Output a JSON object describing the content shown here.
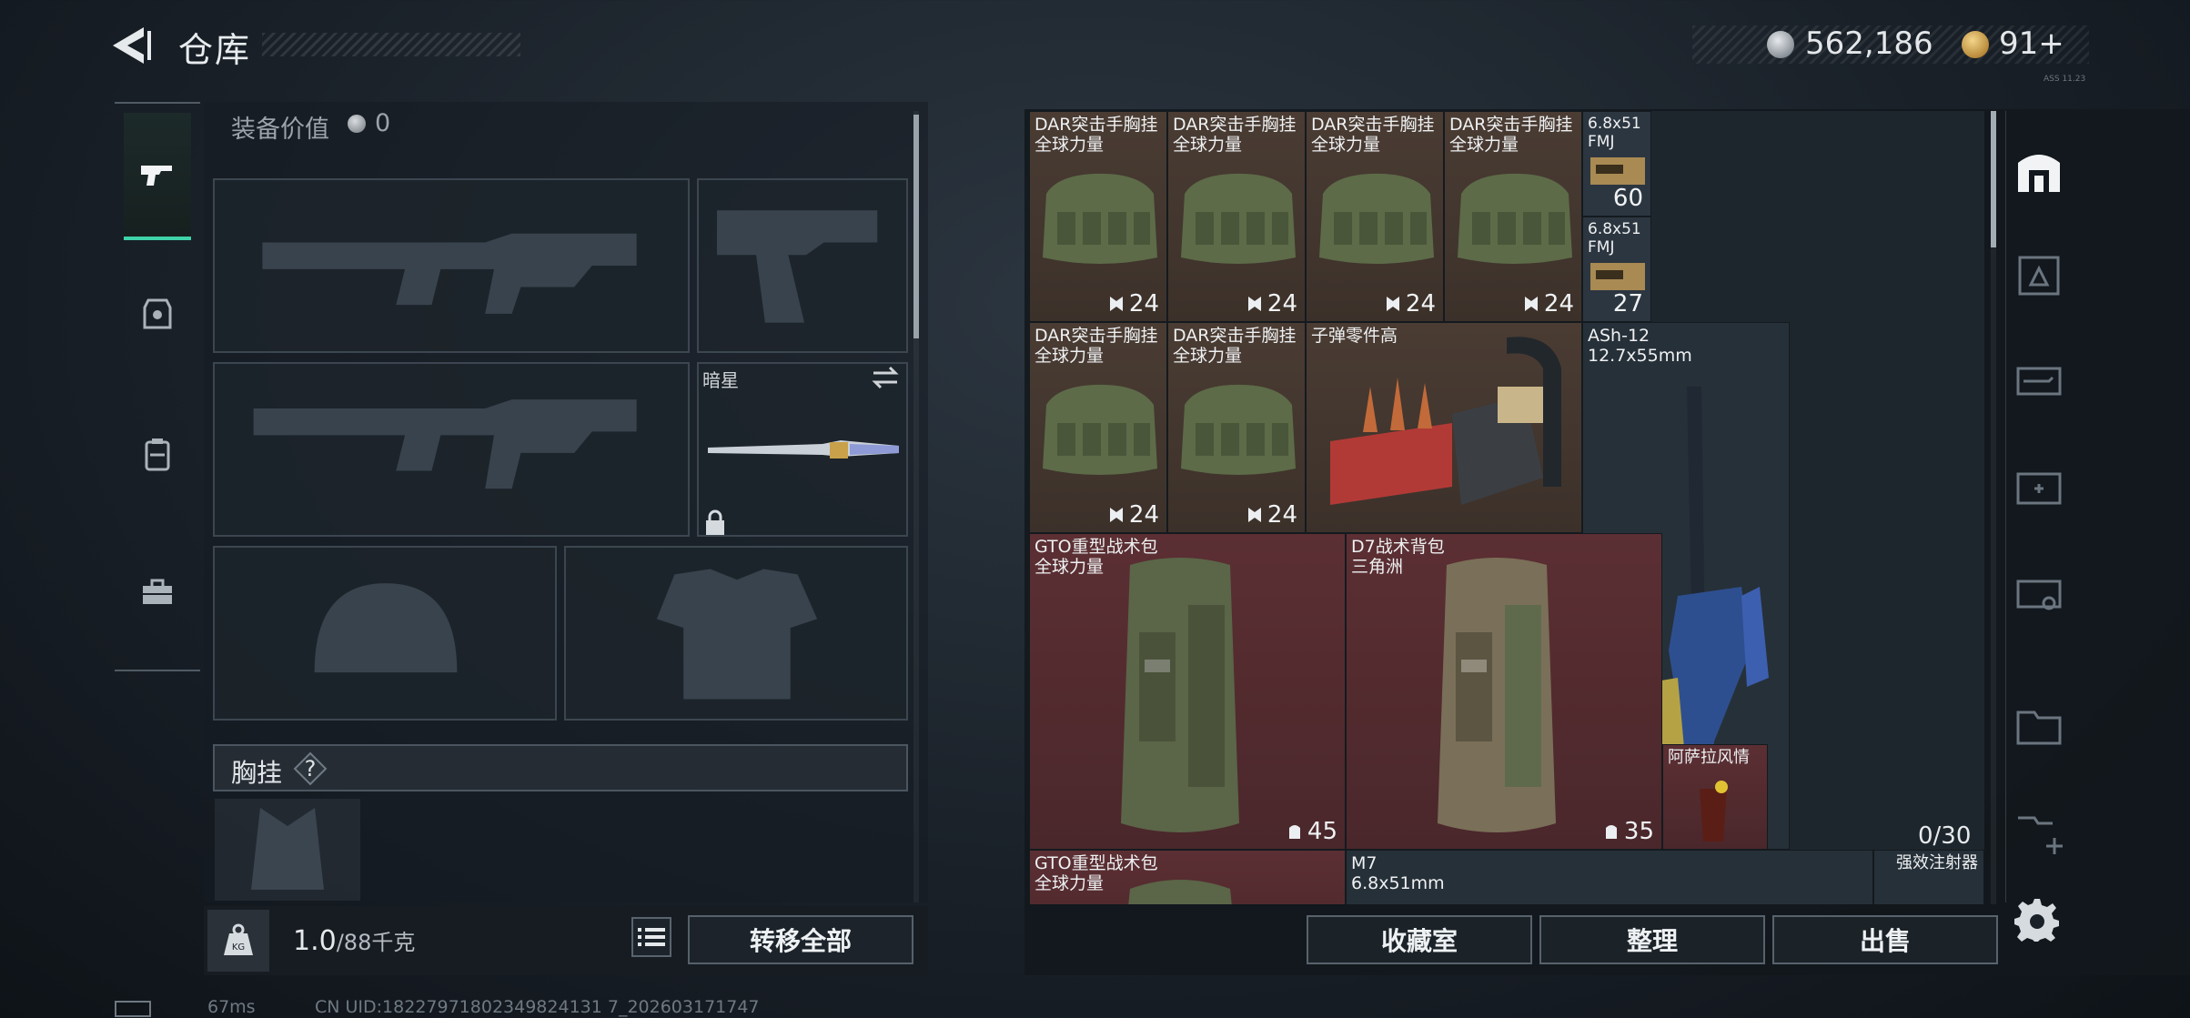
{
  "header": {
    "title": "仓库",
    "money": "562,186",
    "coupons": "91+",
    "tiny_tag": "ASS 11.23"
  },
  "equipment": {
    "value_label": "装备价值",
    "value": "0",
    "melee_label": "暗星",
    "rig_label": "胸挂",
    "help": "?"
  },
  "weight": {
    "current": "1.0",
    "max": "/88千克",
    "icon_text": "KG"
  },
  "actions": {
    "transfer_all": "转移全部",
    "collection": "收藏室",
    "organize": "整理",
    "sell": "出售"
  },
  "stash": {
    "items": [
      {
        "name": "DAR突击手胸挂",
        "sub": "全球力量",
        "count": "24"
      },
      {
        "name": "DAR突击手胸挂",
        "sub": "全球力量",
        "count": "24"
      },
      {
        "name": "DAR突击手胸挂",
        "sub": "全球力量",
        "count": "24"
      },
      {
        "name": "DAR突击手胸挂",
        "sub": "全球力量",
        "count": "24"
      },
      {
        "name": "6.8x51",
        "sub": "FMJ",
        "count": "60"
      },
      {
        "name": "6.8x51",
        "sub": "FMJ",
        "count": "27"
      },
      {
        "name": "DAR突击手胸挂",
        "sub": "全球力量",
        "count": "24"
      },
      {
        "name": "DAR突击手胸挂",
        "sub": "全球力量",
        "count": "24"
      },
      {
        "name": "子弹零件高",
        "sub": "",
        "count": ""
      },
      {
        "name": "ASh-12",
        "sub": "12.7x55mm",
        "count": ""
      },
      {
        "name": "GTO重型战术包",
        "sub": "全球力量",
        "count": "45"
      },
      {
        "name": "D7战术背包",
        "sub": "三角洲",
        "count": "35"
      },
      {
        "name": "阿萨拉风情",
        "sub": "",
        "count": ""
      },
      {
        "name": "GTO重型战术包",
        "sub": "全球力量",
        "count": ""
      },
      {
        "name": "M7",
        "sub": "6.8x51mm",
        "count": ""
      },
      {
        "name": "强效注射器",
        "sub": "",
        "count": ""
      }
    ],
    "capacity": "0/30"
  },
  "status": {
    "ping": "67ms",
    "uid": "CN UID:18227971802349824131 7_202603171747"
  },
  "colors": {
    "accent": "#3fd3a9",
    "cell_brown": "#4a3c33",
    "cell_red": "#5b2f33"
  }
}
